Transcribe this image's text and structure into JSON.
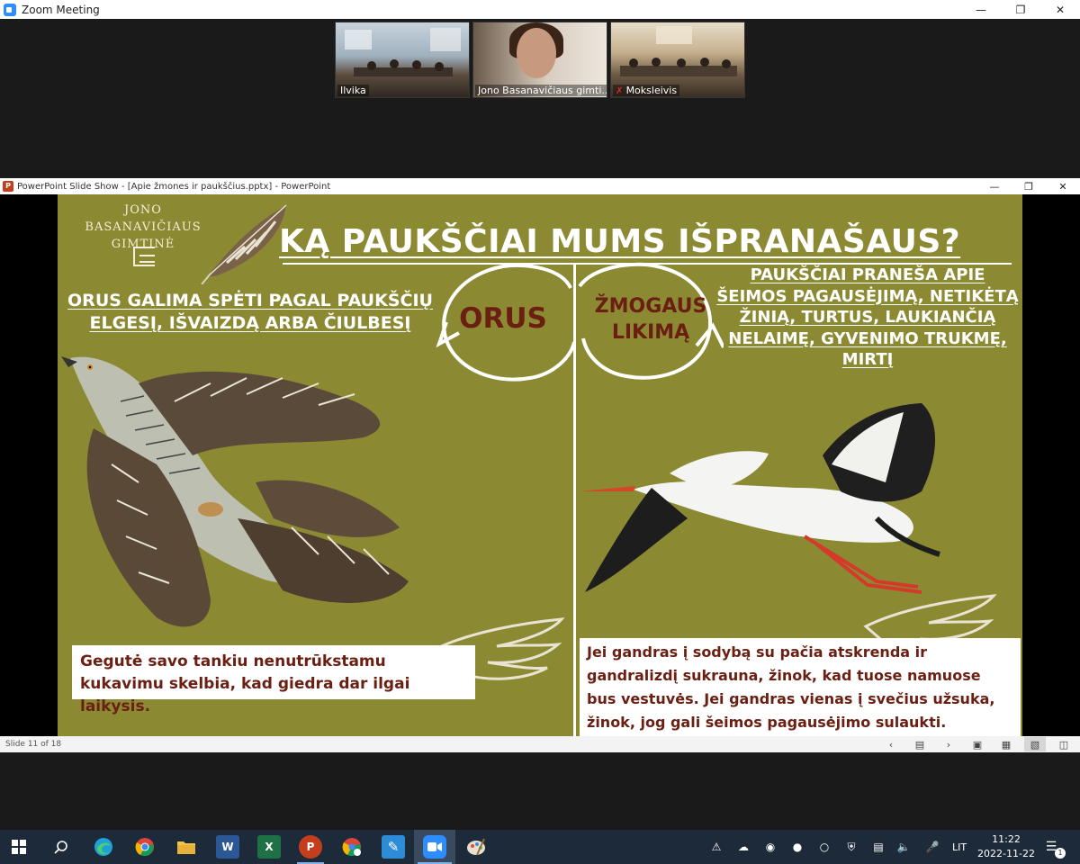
{
  "zoom": {
    "window_title": "Zoom Meeting",
    "participants": [
      {
        "name": "Ilvika"
      },
      {
        "name": "Jono Basanavičiaus gimti..."
      },
      {
        "name": "Moksleivis"
      }
    ]
  },
  "powerpoint": {
    "window_title": "PowerPoint Slide Show - [Apie žmones ir paukščius.pptx] - PowerPoint",
    "status": {
      "slide_counter": "Slide 11 of 18"
    }
  },
  "slide": {
    "brand_line1": "JONO BASANAVIČIAUS",
    "brand_line2": "GIMTINĖ",
    "title": "KĄ PAUKŠČIAI MUMS IŠPRANAŠAUS?",
    "left_subtitle": "ORUS GALIMA SPĖTI PAGAL PAUKŠČIŲ ELGESĮ, IŠVAIZDĄ ARBA ČIULBESĮ",
    "orus_label": "ORUS",
    "zmogaus_label_line1": "ŽMOGAUS",
    "zmogaus_label_line2": "LIKIMĄ",
    "right_subtitle": "PAUKŠČIAI PRANEŠA APIE ŠEIMOS PAGAUSĖJIMĄ, NETIKĖTĄ ŽINIĄ, TURTUS, LAUKIANČIĄ NELAIMĘ, GYVENIMO TRUKMĘ, MIRTĮ",
    "left_text": "Gegutė savo tankiu nenutrūkstamu kukavimu skelbia, kad giedra dar ilgai laikysis.",
    "right_text": "Jei gandras į sodybą su pačia atskrenda ir gandralizdį sukrauna, žinok, kad tuose namuose bus vestuvės. Jei gandras vienas į svečius užsuka, žinok, jog gali šeimos pagausėjimo sulaukti.",
    "colors": {
      "background": "#8b8a33",
      "accent_text": "#6a1f12"
    }
  },
  "taskbar": {
    "apps": [
      "windows-start",
      "search",
      "edge",
      "chrome",
      "file-explorer",
      "word",
      "excel",
      "powerpoint",
      "chrome-alt",
      "whiteboard",
      "zoom",
      "paint"
    ],
    "language": "LIT",
    "time": "11:22",
    "date": "2022-11-22",
    "notification_count": "1"
  }
}
